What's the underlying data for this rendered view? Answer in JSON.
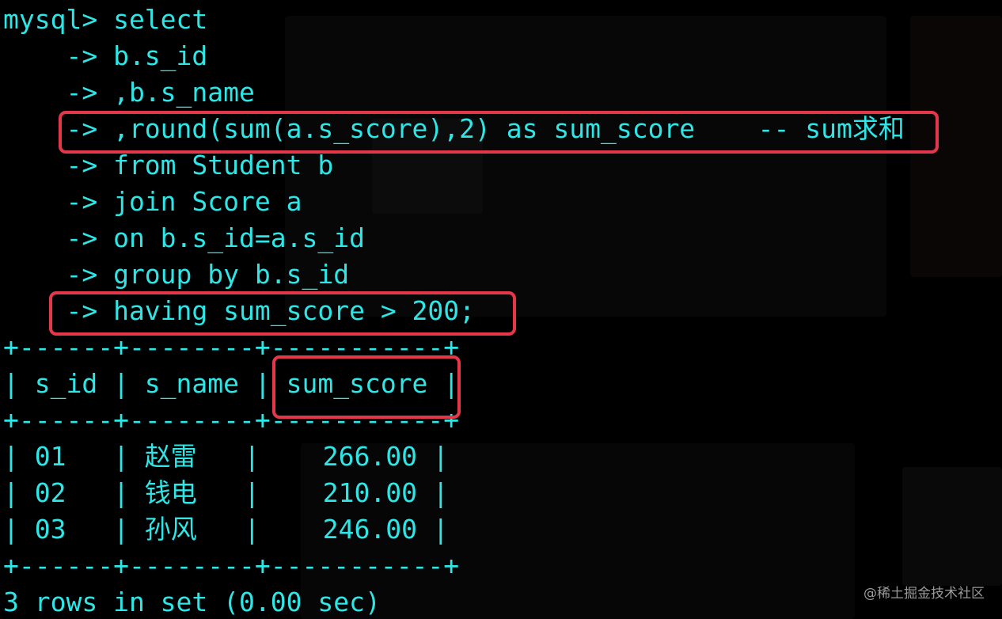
{
  "terminal": {
    "lines": [
      "mysql> select",
      "    -> b.s_id",
      "    -> ,b.s_name",
      "    -> ,round(sum(a.s_score),2) as sum_score    -- sum求和",
      "    -> from Student b",
      "    -> join Score a",
      "    -> on b.s_id=a.s_id",
      "    -> group by b.s_id",
      "    -> having sum_score > 200;",
      "+------+--------+-----------+",
      "| s_id | s_name | sum_score |",
      "+------+--------+-----------+",
      "| 01   | 赵雷   |    266.00 |",
      "| 02   | 钱电   |    210.00 |",
      "| 03   | 孙风   |    246.00 |",
      "+------+--------+-----------+",
      "3 rows in set (0.00 sec)"
    ]
  },
  "watermark": "@稀土掘金技术社区",
  "colors": {
    "text": "#2ee6e6",
    "highlight": "#e4374a",
    "background": "#000000"
  }
}
